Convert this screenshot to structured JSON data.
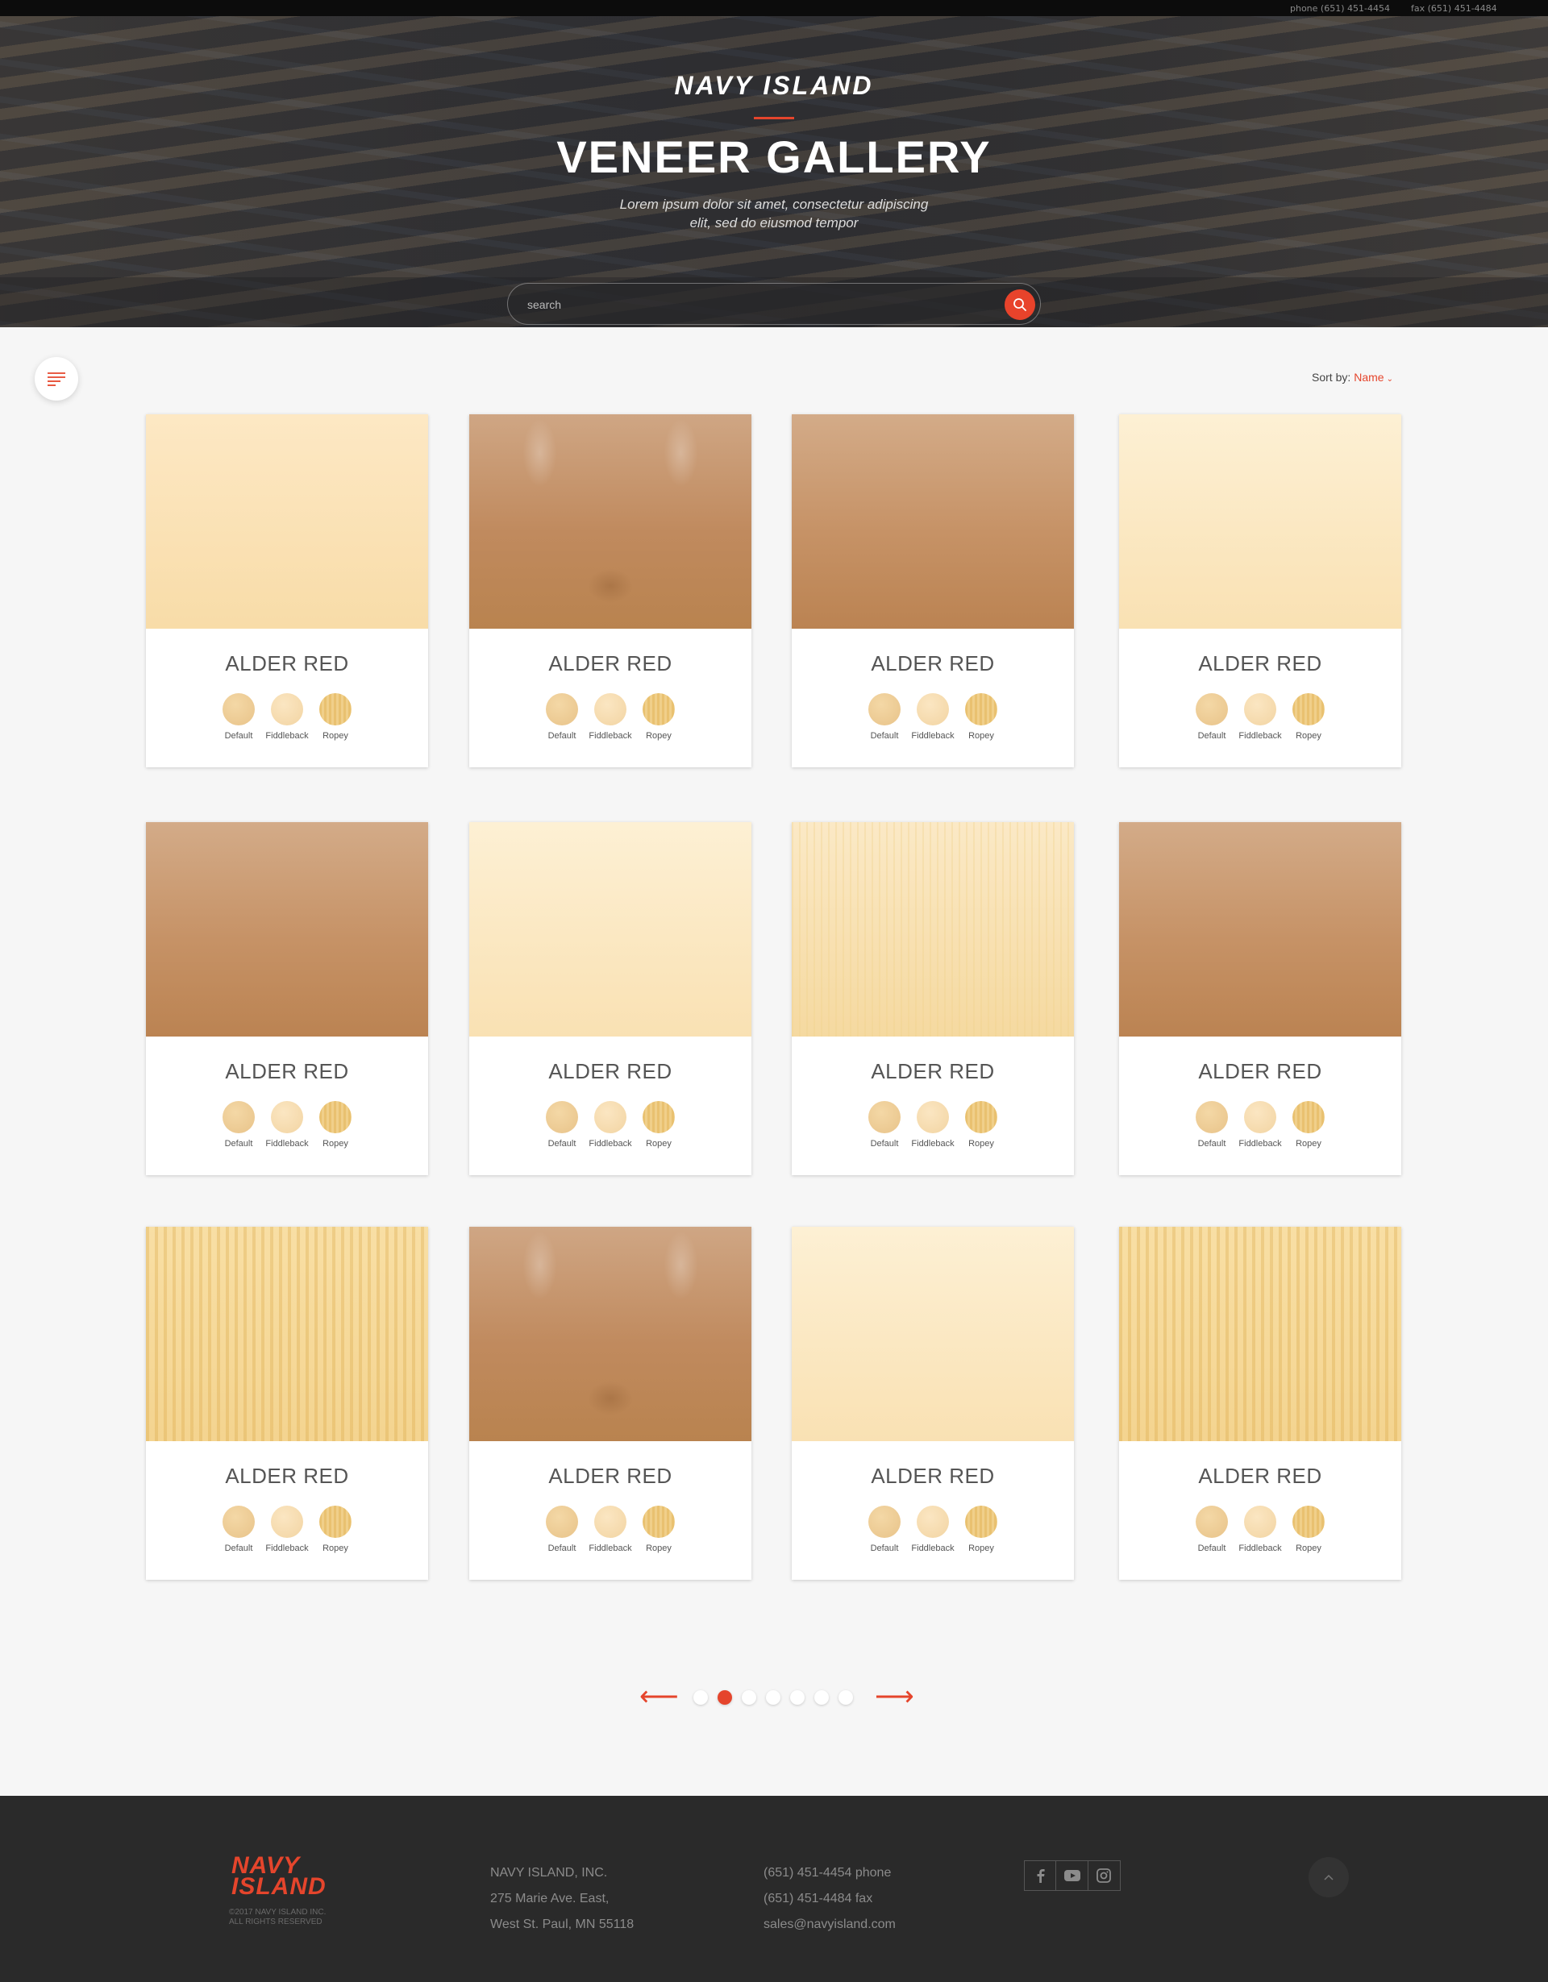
{
  "topbar": {
    "phone": "phone (651) 451-4454",
    "fax": "fax (651) 451-4484"
  },
  "hero": {
    "brand": "NAVY ISLAND",
    "title": "VENEER GALLERY",
    "subtitle_line1": "Lorem ipsum dolor sit amet, consectetur adipiscing",
    "subtitle_line2": "elit, sed do eiusmod tempor",
    "search_placeholder": "search"
  },
  "sort": {
    "label": "Sort by:",
    "value": "Name"
  },
  "cards": [
    {
      "name": "ALDER RED",
      "options": [
        "Default",
        "Fiddleback",
        "Ropey"
      ]
    },
    {
      "name": "ALDER RED",
      "options": [
        "Default",
        "Fiddleback",
        "Ropey"
      ]
    },
    {
      "name": "ALDER RED",
      "options": [
        "Default",
        "Fiddleback",
        "Ropey"
      ]
    },
    {
      "name": "ALDER RED",
      "options": [
        "Default",
        "Fiddleback",
        "Ropey"
      ]
    },
    {
      "name": "ALDER RED",
      "options": [
        "Default",
        "Fiddleback",
        "Ropey"
      ]
    },
    {
      "name": "ALDER RED",
      "options": [
        "Default",
        "Fiddleback",
        "Ropey"
      ]
    },
    {
      "name": "ALDER RED",
      "options": [
        "Default",
        "Fiddleback",
        "Ropey"
      ]
    },
    {
      "name": "ALDER RED",
      "options": [
        "Default",
        "Fiddleback",
        "Ropey"
      ]
    },
    {
      "name": "ALDER RED",
      "options": [
        "Default",
        "Fiddleback",
        "Ropey"
      ]
    },
    {
      "name": "ALDER RED",
      "options": [
        "Default",
        "Fiddleback",
        "Ropey"
      ]
    },
    {
      "name": "ALDER RED",
      "options": [
        "Default",
        "Fiddleback",
        "Ropey"
      ]
    },
    {
      "name": "ALDER RED",
      "options": [
        "Default",
        "Fiddleback",
        "Ropey"
      ]
    }
  ],
  "pagination": {
    "pages": 7,
    "active_page": 2
  },
  "footer": {
    "logo_line1": "NAVY",
    "logo_line2": "ISLAND",
    "copyright_line1": "©2017 NAVY ISLAND INC.",
    "copyright_line2": "ALL RIGHTS RESERVED",
    "company": "NAVY ISLAND, INC.",
    "address1": "275 Marie Ave. East,",
    "address2": "West St. Paul, MN 55118",
    "phone": "(651) 451-4454 phone",
    "fax": "(651) 451-4484 fax",
    "email": "sales@navyisland.com",
    "social": [
      "facebook-icon",
      "youtube-icon",
      "instagram-icon"
    ]
  },
  "colors": {
    "accent": "#e5452c",
    "footer_bg": "#2a2a2a",
    "page_bg": "#f6f6f6"
  }
}
